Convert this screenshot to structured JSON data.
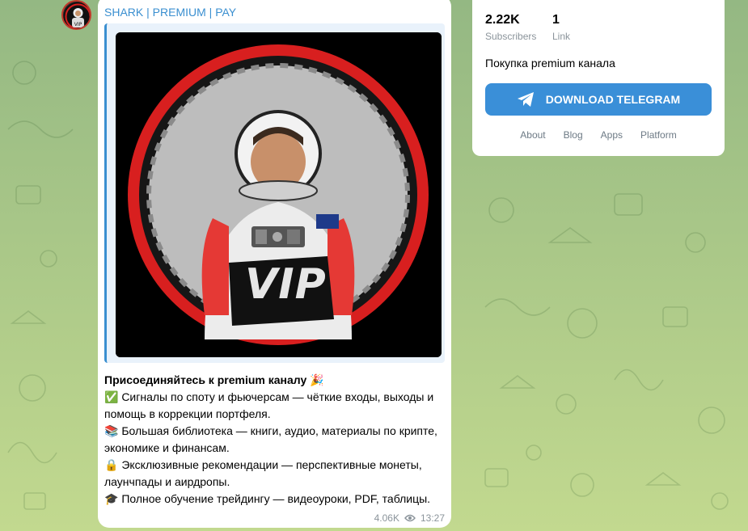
{
  "channel": {
    "name_parts": [
      "SHARK",
      "PREMIUM",
      "PAY"
    ],
    "separator": "|"
  },
  "post": {
    "image_badge": "VIP",
    "lines": [
      "Присоединяйтесь к premium каналу 🎉",
      "✅ Сигналы по споту и фьючерсам — чёткие входы, выходы и",
      "помощь в коррекции портфеля.",
      "📚 Большая библиотека — книги, аудио, материалы по крипте,",
      "экономике и финансам.",
      "🔒 Эксклюзивные рекомендации — перспективные монеты,",
      "лаунчпады и аирдропы.",
      "🎓 Полное обучение трейдингу — видеоуроки, PDF, таблицы."
    ],
    "views": "4.06K",
    "time": "13:27"
  },
  "card": {
    "subscribers_value": "2.22K",
    "subscribers_label": "Subscribers",
    "links_value": "1",
    "links_label": "Link",
    "description": "Покупка premium канала",
    "download_label": "DOWNLOAD TELEGRAM",
    "footer_links": [
      "About",
      "Blog",
      "Apps",
      "Platform"
    ]
  },
  "colors": {
    "accent": "#3a8fd8",
    "link": "#3a8fd0",
    "muted": "#8b949b",
    "vip_ring": "#d81f1f"
  },
  "icons": {
    "telegram": "paper-plane-icon",
    "views": "eye-icon"
  }
}
